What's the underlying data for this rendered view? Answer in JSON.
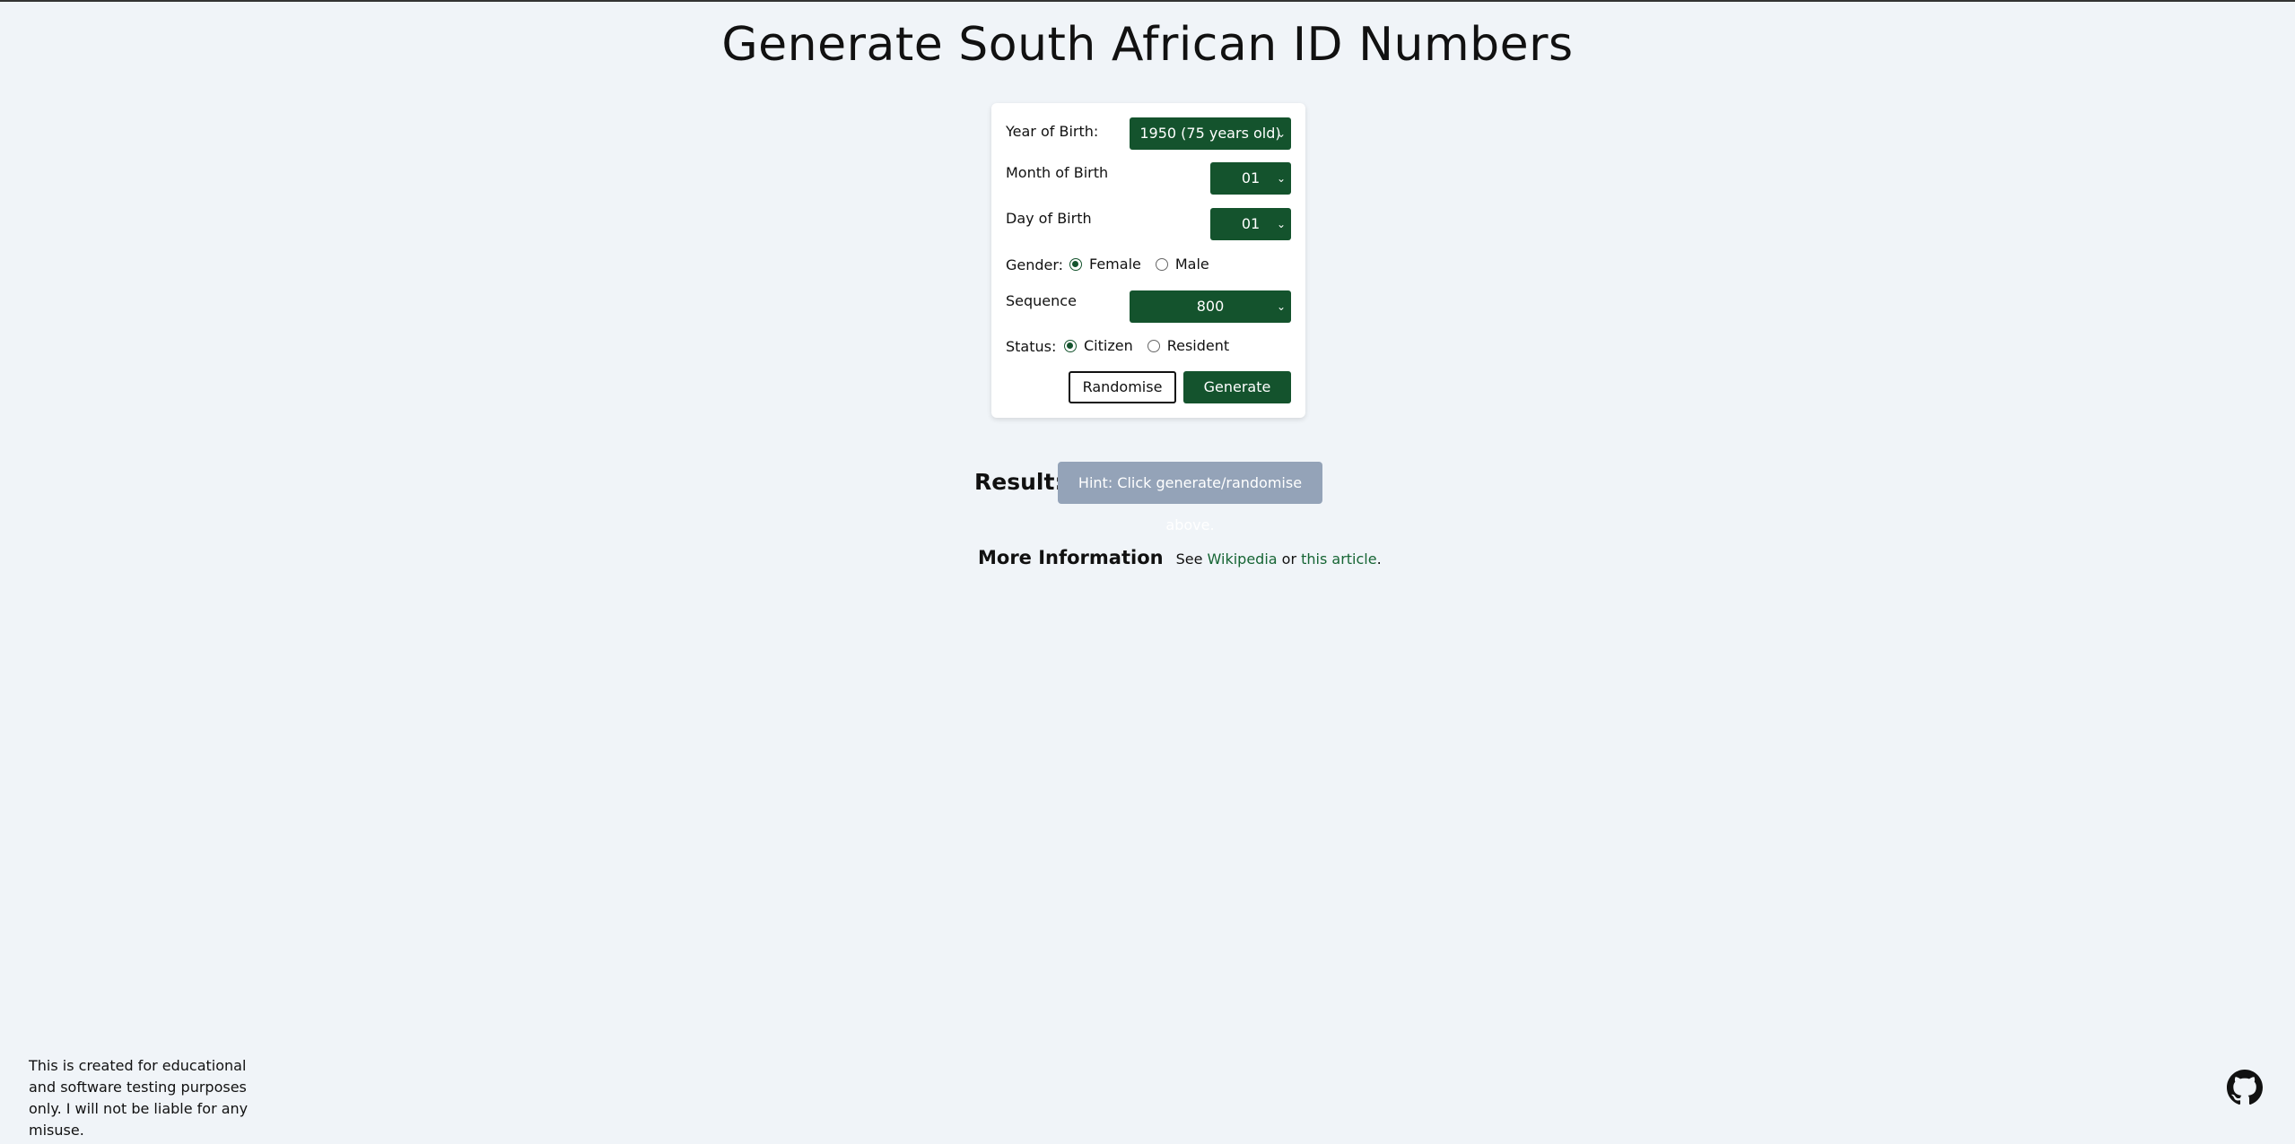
{
  "page": {
    "title": "Generate South African ID Numbers"
  },
  "form": {
    "year": {
      "label": "Year of Birth:",
      "value": "1950 (75 years old)"
    },
    "month": {
      "label": "Month of Birth",
      "value": "01"
    },
    "day": {
      "label": "Day of Birth",
      "value": "01"
    },
    "gender": {
      "label": "Gender:",
      "options": [
        "Female",
        "Male"
      ],
      "selected": "Female"
    },
    "sequence": {
      "label": "Sequence",
      "value": "800"
    },
    "status": {
      "label": "Status:",
      "options": [
        "Citizen",
        "Resident"
      ],
      "selected": "Citizen"
    },
    "buttons": {
      "randomise": "Randomise",
      "generate": "Generate"
    }
  },
  "result": {
    "label": "Result:",
    "hint": "Hint: Click generate/randomise above."
  },
  "more_info": {
    "heading": "More Information",
    "prefix": "See ",
    "link1": "Wikipedia",
    "middle": " or ",
    "link2": "this article",
    "suffix": "."
  },
  "footer": {
    "note": "This is created for educational and software testing purposes only. I will not be liable for any misuse."
  },
  "icons": {
    "chevron": "chevron-down-icon",
    "github": "github-icon"
  },
  "colors": {
    "accent": "#14532d",
    "background": "#f0f4f8",
    "hint_box": "#94a3b8",
    "link": "#166534"
  }
}
